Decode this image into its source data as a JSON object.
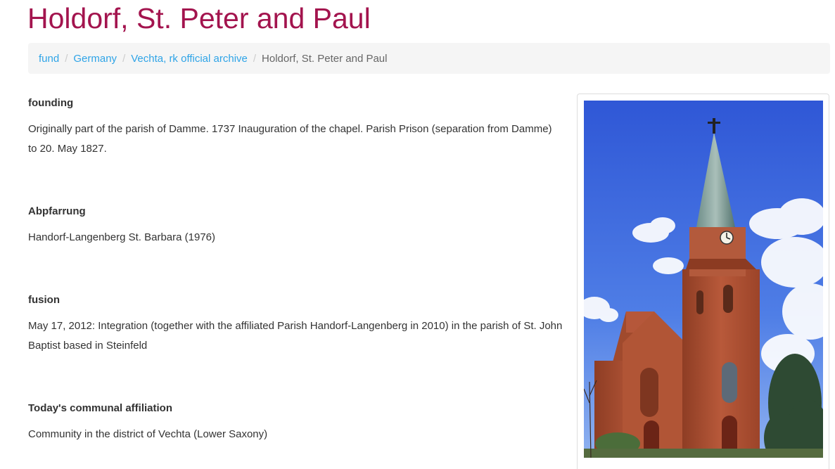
{
  "page": {
    "title": "Holdorf, St. Peter and Paul"
  },
  "breadcrumb": {
    "items": [
      "fund",
      "Germany",
      "Vechta, rk official archive"
    ],
    "separator": "/",
    "current": "Holdorf, St. Peter and Paul"
  },
  "sections": [
    {
      "heading": "founding",
      "body": "Originally part of the parish of Damme. 1737 Inauguration of the chapel. Parish Prison (separation from Damme) to 20. May 1827."
    },
    {
      "heading": "Abpfarrung",
      "body": "Handorf-Langenberg St. Barbara (1976)"
    },
    {
      "heading": "fusion",
      "body": "May 17, 2012: Integration (together with the affiliated Parish Handorf-Langenberg in 2010) in the parish of St. John Baptist based in Steinfeld"
    },
    {
      "heading": "Today's communal affiliation",
      "body": "Community in the district of Vechta (Lower Saxony)"
    }
  ],
  "colors": {
    "title": "#a3144e",
    "link": "#2fa4e7",
    "breadcrumb_bg": "#f5f5f5",
    "text": "#333333"
  }
}
